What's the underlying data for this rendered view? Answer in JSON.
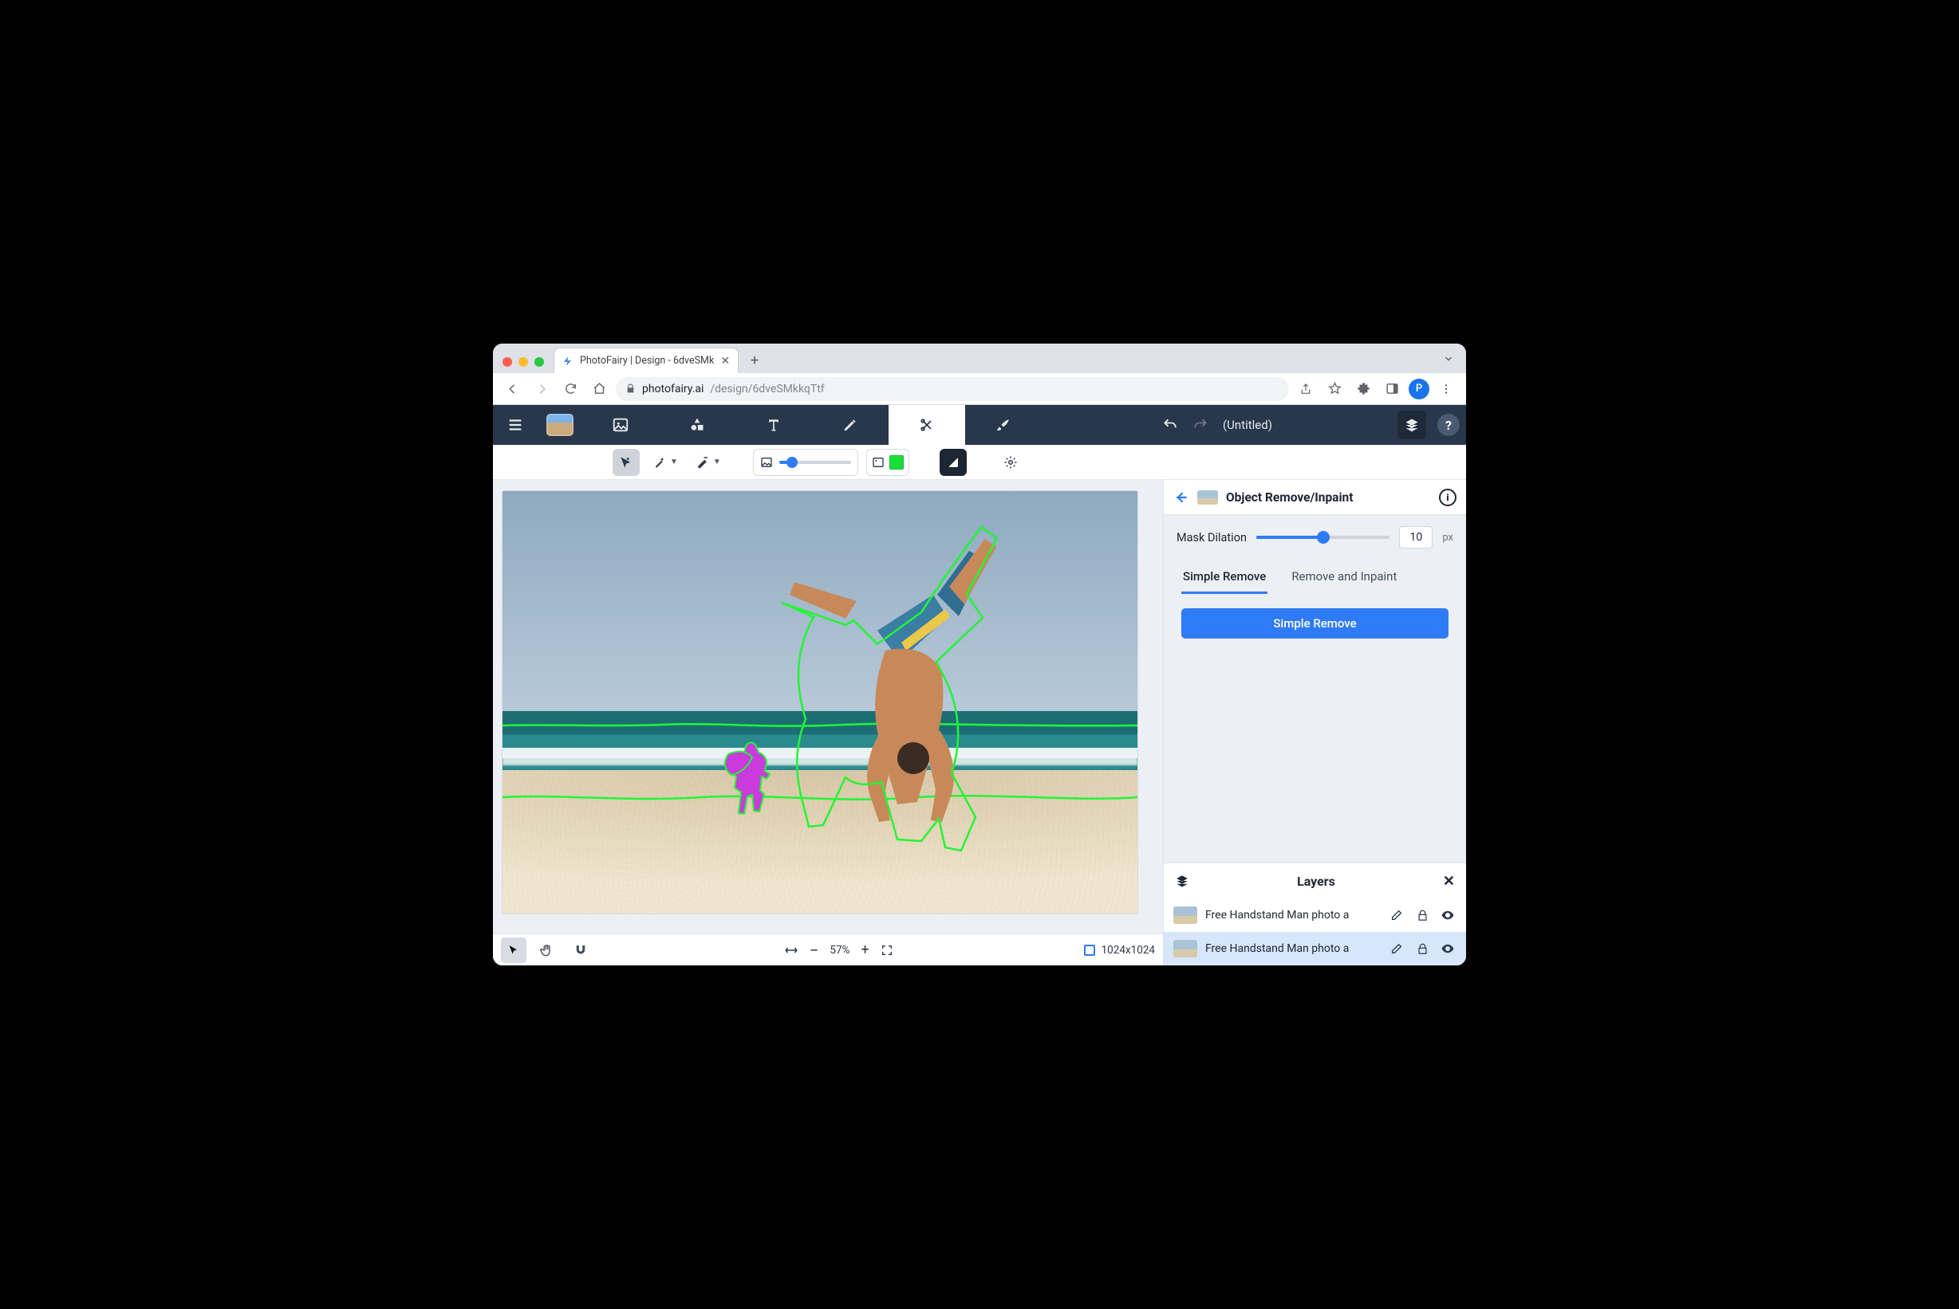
{
  "browser": {
    "tab_title": "PhotoFairy | Design - 6dveSMk",
    "url_host": "photofairy.ai",
    "url_path": "/design/6dveSMkkqTtf",
    "avatar_initial": "P"
  },
  "app": {
    "document_title": "(Untitled)"
  },
  "subtoolbar": {
    "opacity_percent": 18
  },
  "panel": {
    "title": "Object Remove/Inpaint",
    "mask_dilation_label": "Mask Dilation",
    "mask_dilation_value": "10",
    "mask_dilation_unit": "px",
    "tabs": {
      "simple": "Simple Remove",
      "inpaint": "Remove and Inpaint"
    },
    "primary_button": "Simple Remove"
  },
  "layers": {
    "title": "Layers",
    "items": [
      {
        "name": "Free Handstand Man photo a"
      },
      {
        "name": "Free Handstand Man photo a"
      }
    ]
  },
  "status": {
    "zoom": "57%",
    "canvas_size": "1024x1024"
  }
}
